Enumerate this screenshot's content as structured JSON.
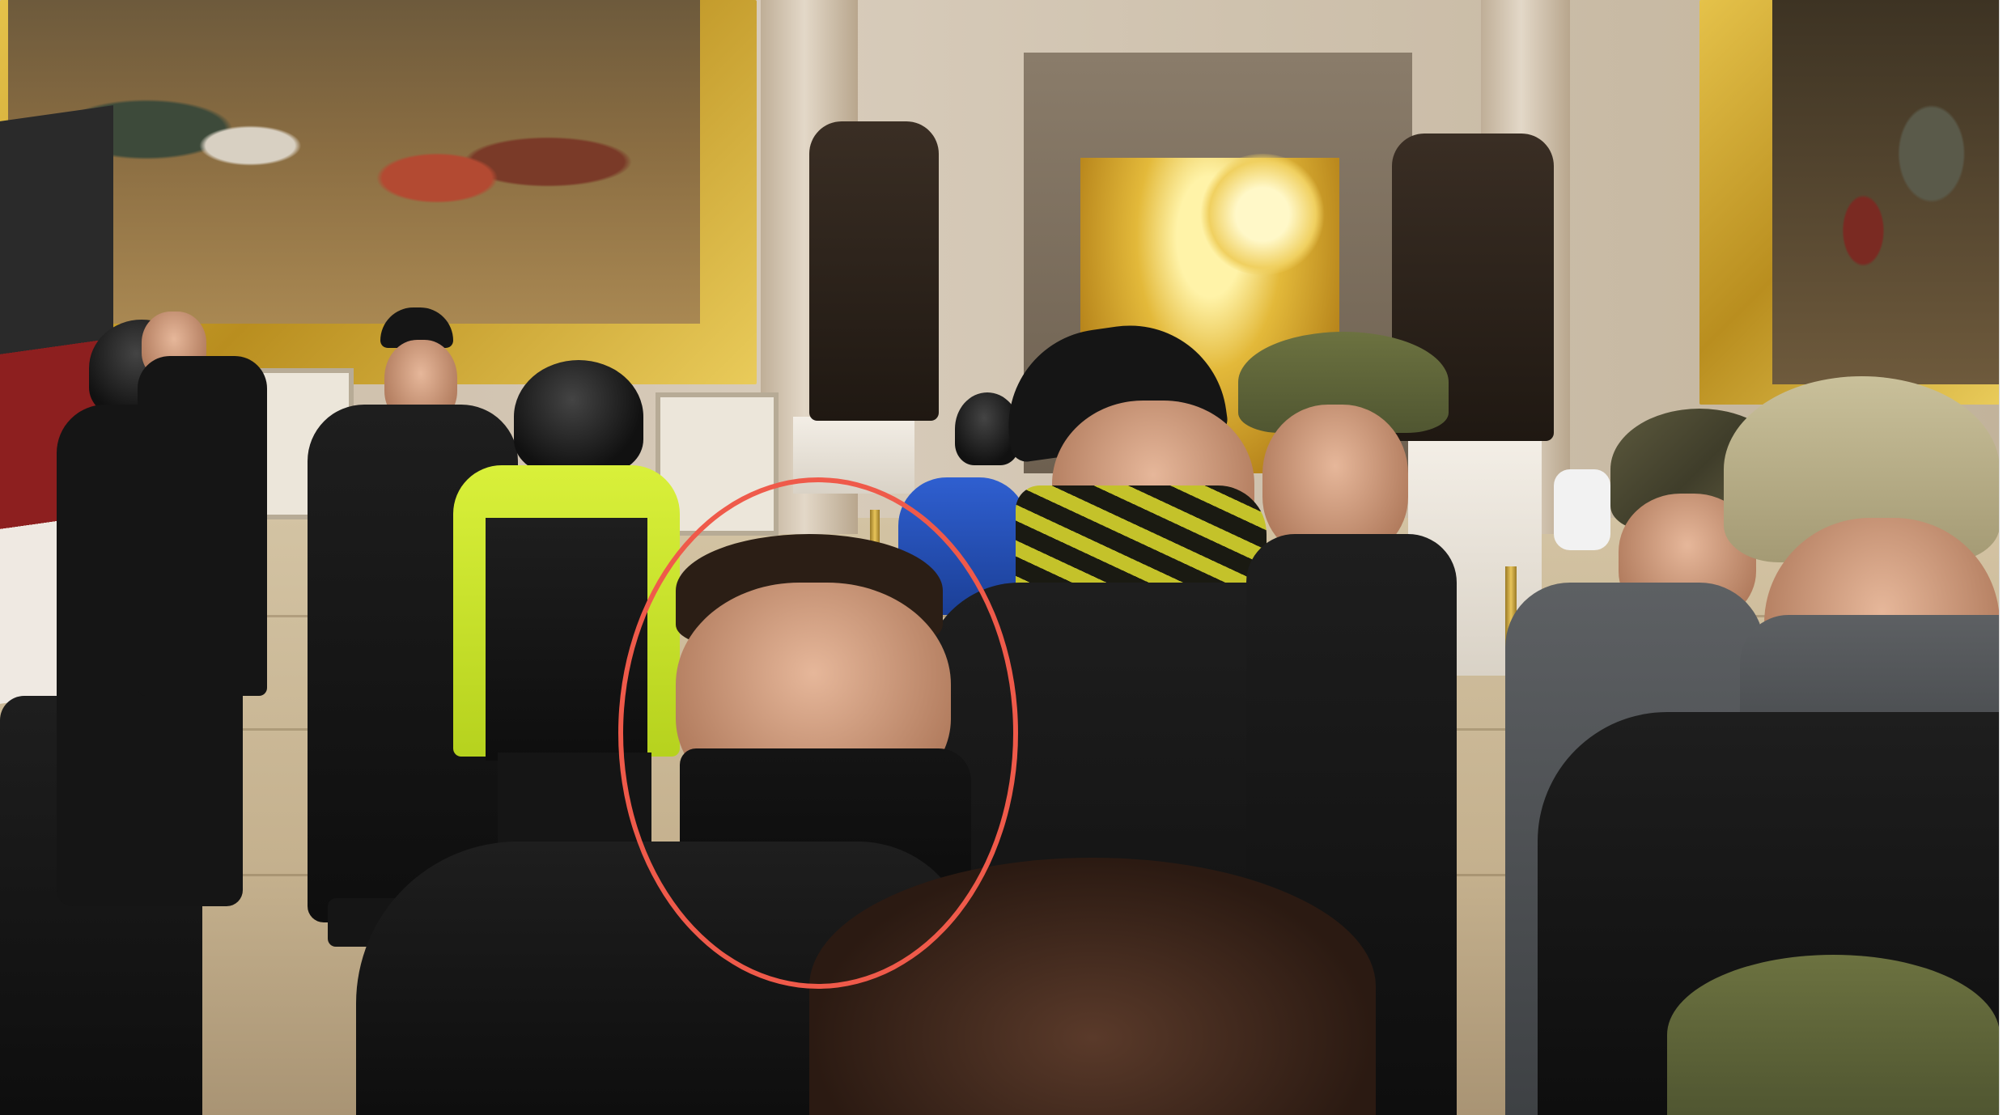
{
  "scene": {
    "setting": "rotunda",
    "highlight": {
      "shape": "ellipse",
      "color": "#ef5a4a"
    }
  },
  "colors": {
    "annotation": "#ef5a4a",
    "hi_vis": "#d9f03a",
    "gold_frame": "#d4ab34"
  },
  "icons": [
    "rotunda-painting",
    "bronze-statue",
    "chandelier",
    "stanchion"
  ]
}
